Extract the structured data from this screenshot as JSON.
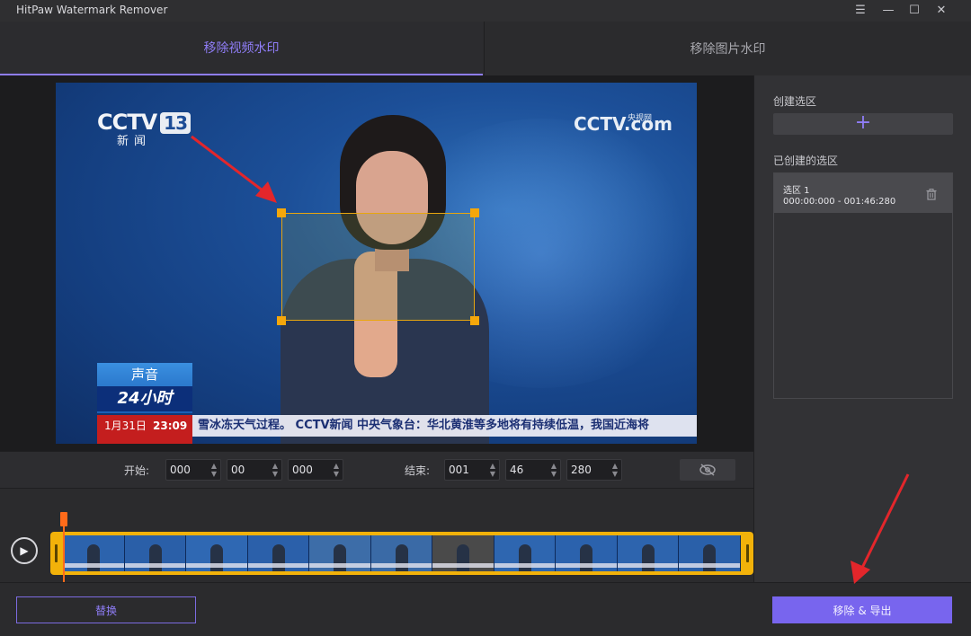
{
  "window": {
    "title": "HitPaw Watermark Remover",
    "controls": {
      "menu": "☰",
      "minimize": "—",
      "maximize": "☐",
      "close": "✕"
    }
  },
  "tabs": [
    {
      "label": "移除视频水印",
      "active": true
    },
    {
      "label": "移除图片水印",
      "active": false
    }
  ],
  "video": {
    "logo_left": "CCTV",
    "logo_left_channel": "13",
    "logo_left_sub": "新闻",
    "logo_right": "CCTV.com",
    "logo_right_sub": "央视网",
    "lower_third_top": "声音",
    "lower_third_bottom": "24小时",
    "ticker_date": "1月31日",
    "ticker_time": "23:09",
    "ticker_text": "雪冰冻天气过程。   CCTV新闻   中央气象台：华北黄淮等多地将有持续低温，我国近海将"
  },
  "time": {
    "start_label": "开始:",
    "start": [
      "000",
      "00",
      "000"
    ],
    "end_label": "结束:",
    "end": [
      "001",
      "46",
      "280"
    ],
    "spin_arrows": "◇"
  },
  "timeline": {
    "play": "▶",
    "frame_count": 11
  },
  "right_panel": {
    "create_label": "创建选区",
    "add_symbol": "+",
    "created_label": "已创建的选区",
    "regions": [
      {
        "name": "选区 1",
        "range": "000:00:000 - 001:46:280"
      }
    ]
  },
  "buttons": {
    "replace": "替换",
    "export": "移除 & 导出"
  },
  "colors": {
    "accent": "#8f7df6",
    "export_bg": "#7865ee",
    "selection": "#f5a70b",
    "playhead": "#ff6b1a",
    "annotation_arrow": "#e3262b"
  }
}
